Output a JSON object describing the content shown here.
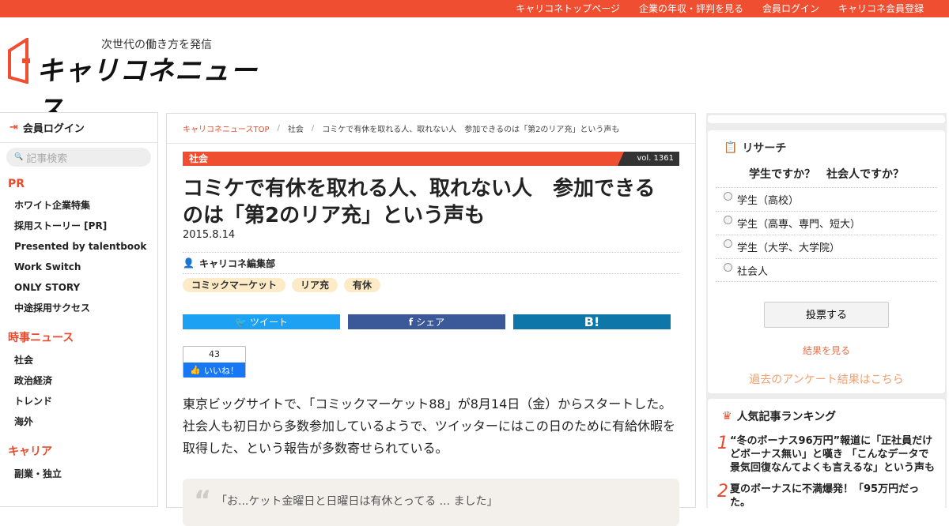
{
  "topnav": [
    "キャリコネトップページ",
    "企業の年収・評判を見る",
    "会員ログイン",
    "キャリコネ会員登録"
  ],
  "logo": {
    "tagline": "次世代の働き方を発信",
    "name": "キャリコネニュース"
  },
  "left": {
    "login": "会員ログイン",
    "search_placeholder": "記事検索",
    "sections": [
      {
        "title": "PR",
        "items": [
          "ホワイト企業特集",
          "採用ストーリー [PR]",
          "Presented by talentbook",
          "Work Switch",
          "ONLY STORY",
          "中途採用サクセス"
        ]
      },
      {
        "title": "時事ニュース",
        "items": [
          "社会",
          "政治経済",
          "トレンド",
          "海外"
        ]
      },
      {
        "title": "キャリア",
        "items": [
          "副業・独立"
        ]
      }
    ]
  },
  "article": {
    "breadcrumb": [
      "キャリコネニュースTOP",
      "社会",
      "コミケで有休を取れる人、取れない人　参加できるのは「第2のリア充」という声も"
    ],
    "category": "社会",
    "vol": "vol. 1361",
    "title": "コミケで有休を取れる人、取れない人　参加できるのは「第2のリア充」という声も",
    "date": "2015.8.14",
    "author": "キャリコネ編集部",
    "tags": [
      "コミックマーケット",
      "リア充",
      "有休"
    ],
    "share": {
      "tweet": "ツイート",
      "share": "シェア",
      "hatena": "B!"
    },
    "like": {
      "count": "43",
      "label": "いいね！"
    },
    "body": "東京ビッグサイトで、「コミックマーケット88」が8月14日（金）からスタートした。社会人も初日から多数参加しているようで、ツイッターにはこの日のために有給休暇を取得した、という報告が多数寄せられている。",
    "quote": "「お...ケット金曜日と日曜日は有休とってる ... ました」"
  },
  "research": {
    "heading": "リサーチ",
    "question": "学生ですか？　社会人ですか？",
    "options": [
      "学生（高校）",
      "学生（高専、専門、短大）",
      "学生（大学、大学院）",
      "社会人"
    ],
    "vote": "投票する",
    "results": "結果を見る",
    "past": "過去のアンケート結果はこちら"
  },
  "ranking": {
    "heading": "人気記事ランキング",
    "items": [
      {
        "rank": "1",
        "title": "“冬のボーナス96万円”報道に「正社員だけどボーナス無い」と嘆き 「こんなデータで景気回復なんてよくも言えるな」という声も"
      },
      {
        "rank": "2",
        "title": "夏のボーナスに不満爆発！「95万円だった。"
      }
    ]
  },
  "colors": {
    "accent": "#f04e31",
    "twitter": "#1da1f2",
    "facebook": "#3b5998",
    "hatena": "#0e76a8"
  }
}
